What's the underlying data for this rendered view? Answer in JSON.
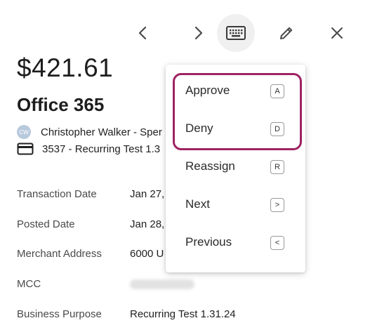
{
  "toolbar": {
    "prev_icon": "chevron-left-icon",
    "next_icon": "chevron-right-icon",
    "keyboard_icon": "keyboard-icon",
    "edit_icon": "pencil-icon",
    "close_icon": "close-icon"
  },
  "transaction": {
    "amount": "$421.61",
    "merchant": "Office 365",
    "cardholder_initials": "CW",
    "cardholder": "Christopher Walker - Sper",
    "card": "3537 - Recurring Test 1.3"
  },
  "details": [
    {
      "label": "Transaction Date",
      "value": "Jan 27,"
    },
    {
      "label": "Posted Date",
      "value": "Jan 28,"
    },
    {
      "label": "Merchant Address",
      "value": "6000 U"
    },
    {
      "label": "MCC",
      "value": ""
    },
    {
      "label": "Business Purpose",
      "value": "Recurring Test 1.31.24"
    }
  ],
  "shortcut_menu": {
    "items": [
      {
        "label": "Approve",
        "key": "A"
      },
      {
        "label": "Deny",
        "key": "D"
      },
      {
        "label": "Reassign",
        "key": "R"
      },
      {
        "label": "Next",
        "key": ">"
      },
      {
        "label": "Previous",
        "key": "<"
      }
    ]
  },
  "colors": {
    "highlight": "#9e2363",
    "avatar_bg": "#b9c9dd"
  }
}
